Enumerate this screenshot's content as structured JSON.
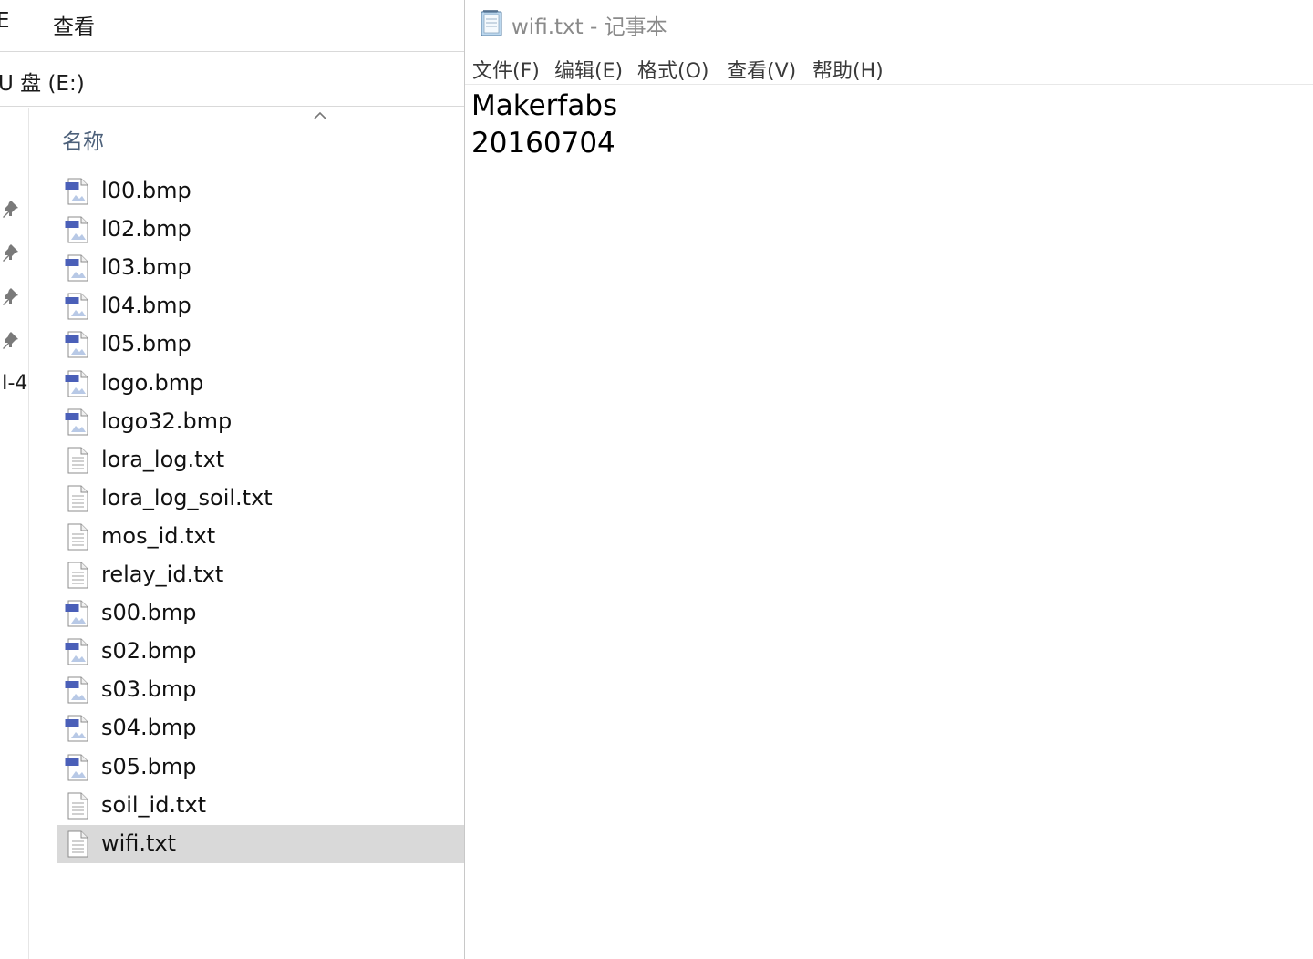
{
  "explorer": {
    "ribbon": {
      "cut_tab": "E",
      "view_tab": "查看"
    },
    "address": "U 盘 (E:)",
    "nav_cut_label": "I-4",
    "column_header": "名称",
    "files": [
      {
        "name": "l00.bmp",
        "type": "bmp",
        "icon": "bmp-file-icon"
      },
      {
        "name": "l02.bmp",
        "type": "bmp",
        "icon": "bmp-file-icon"
      },
      {
        "name": "l03.bmp",
        "type": "bmp",
        "icon": "bmp-file-icon"
      },
      {
        "name": "l04.bmp",
        "type": "bmp",
        "icon": "bmp-file-icon"
      },
      {
        "name": "l05.bmp",
        "type": "bmp",
        "icon": "bmp-file-icon"
      },
      {
        "name": "logo.bmp",
        "type": "bmp",
        "icon": "bmp-file-icon"
      },
      {
        "name": "logo32.bmp",
        "type": "bmp",
        "icon": "bmp-file-icon"
      },
      {
        "name": "lora_log.txt",
        "type": "txt",
        "icon": "text-file-icon"
      },
      {
        "name": "lora_log_soil.txt",
        "type": "txt",
        "icon": "text-file-icon"
      },
      {
        "name": "mos_id.txt",
        "type": "txt",
        "icon": "text-file-icon"
      },
      {
        "name": "relay_id.txt",
        "type": "txt",
        "icon": "text-file-icon"
      },
      {
        "name": "s00.bmp",
        "type": "bmp",
        "icon": "bmp-file-icon"
      },
      {
        "name": "s02.bmp",
        "type": "bmp",
        "icon": "bmp-file-icon"
      },
      {
        "name": "s03.bmp",
        "type": "bmp",
        "icon": "bmp-file-icon"
      },
      {
        "name": "s04.bmp",
        "type": "bmp",
        "icon": "bmp-file-icon"
      },
      {
        "name": "s05.bmp",
        "type": "bmp",
        "icon": "bmp-file-icon"
      },
      {
        "name": "soil_id.txt",
        "type": "txt",
        "icon": "text-file-icon"
      },
      {
        "name": "wifi.txt",
        "type": "txt",
        "icon": "text-file-icon",
        "selected": true
      }
    ],
    "colors": {
      "selection": "#d9d9d9",
      "header_text": "#4c607a",
      "bmp_badge": "#4a5fb8"
    }
  },
  "notepad": {
    "title": "wifi.txt - 记事本",
    "menu": [
      "文件(F)",
      "编辑(E)",
      "格式(O)",
      "查看(V)",
      "帮助(H)"
    ],
    "content_lines": [
      "Makerfabs",
      "20160704"
    ]
  }
}
